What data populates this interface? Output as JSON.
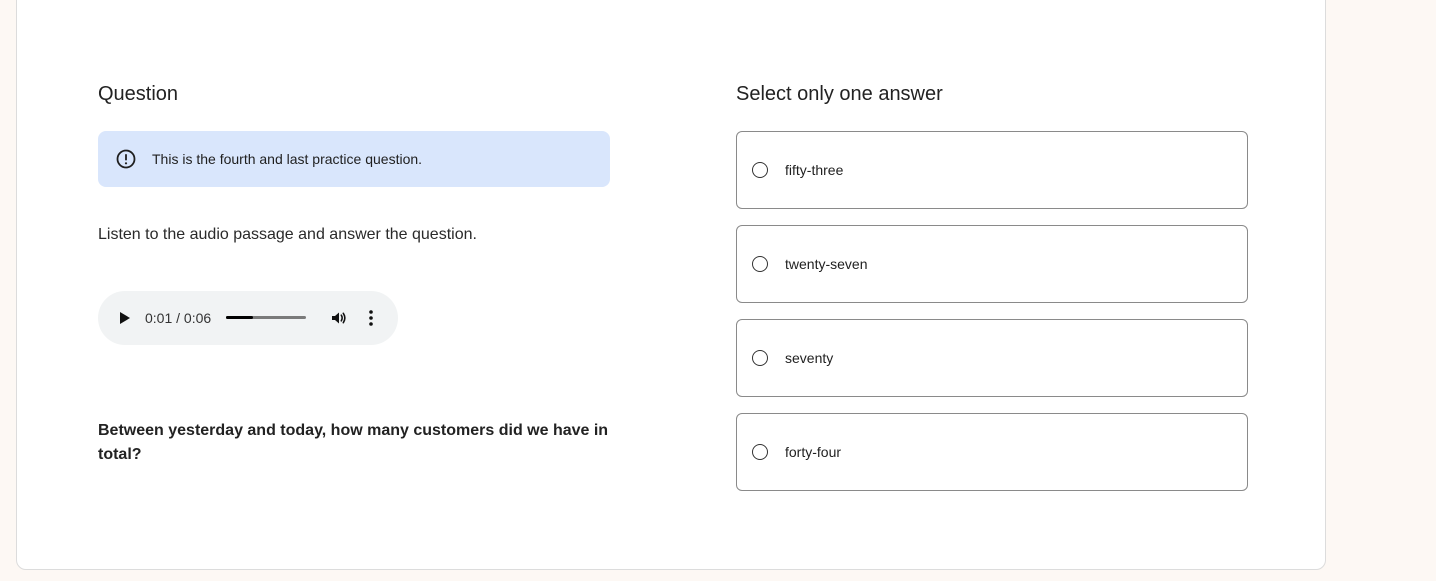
{
  "left": {
    "heading": "Question",
    "info": {
      "icon": "alert-circle-icon",
      "text": "This is the fourth and last practice question."
    },
    "instruction": "Listen to the audio passage and answer the question.",
    "audio": {
      "current_time": "0:01",
      "duration": "0:06",
      "time_label": "0:01 / 0:06",
      "progress": 0.33,
      "icons": [
        "play-icon",
        "volume-icon",
        "more-vertical-icon"
      ]
    },
    "question": "Between yesterday and today, how many customers did we have in total?"
  },
  "right": {
    "heading": "Select only one answer",
    "options": [
      {
        "label": "fifty-three",
        "selected": false
      },
      {
        "label": "twenty-seven",
        "selected": false
      },
      {
        "label": "seventy",
        "selected": false
      },
      {
        "label": "forty-four",
        "selected": false
      }
    ]
  },
  "colors": {
    "page_background": "#fdf8f4",
    "info_background": "#d9e6fc",
    "audio_background": "#f1f3f4",
    "option_border": "#8a8a8a"
  }
}
